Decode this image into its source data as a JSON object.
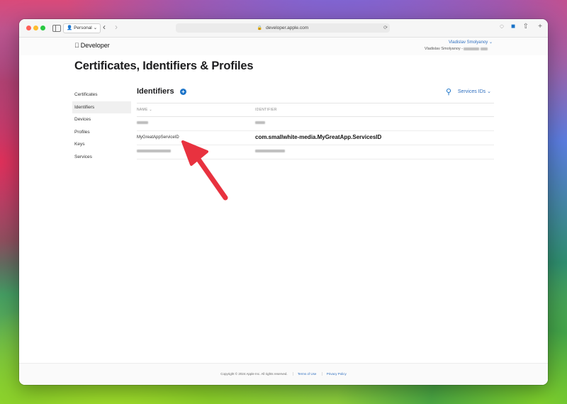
{
  "browser": {
    "profile_label": "Personal",
    "url": "developer.apple.com"
  },
  "header": {
    "brand": "Developer",
    "user_name": "Vladislav Smolyanoy",
    "team_label": "Vladislav Smolyanoy -"
  },
  "page": {
    "title": "Certificates, Identifiers & Profiles"
  },
  "sidebar": {
    "items": [
      {
        "label": "Certificates",
        "active": false
      },
      {
        "label": "Identifiers",
        "active": true
      },
      {
        "label": "Devices",
        "active": false
      },
      {
        "label": "Profiles",
        "active": false
      },
      {
        "label": "Keys",
        "active": false
      },
      {
        "label": "Services",
        "active": false
      }
    ]
  },
  "main": {
    "title": "Identifiers",
    "add_label": "+",
    "filter_label": "Services IDs",
    "columns": {
      "name": "NAME",
      "identifier": "IDENTIFIER"
    },
    "rows": [
      {
        "name": "",
        "identifier": "",
        "redacted": true
      },
      {
        "name": "MyGreatAppServiceID",
        "identifier": "com.smallwhite-media.MyGreatApp.ServicesID",
        "redacted": false
      },
      {
        "name": "",
        "identifier": "",
        "redacted": true
      }
    ]
  },
  "footer": {
    "copyright": "Copyright © 2024 Apple Inc. All rights reserved.",
    "terms": "Terms of Use",
    "privacy": "Privacy Policy"
  },
  "colors": {
    "accent": "#1a73c8",
    "annotation_arrow": "#e8323f"
  }
}
